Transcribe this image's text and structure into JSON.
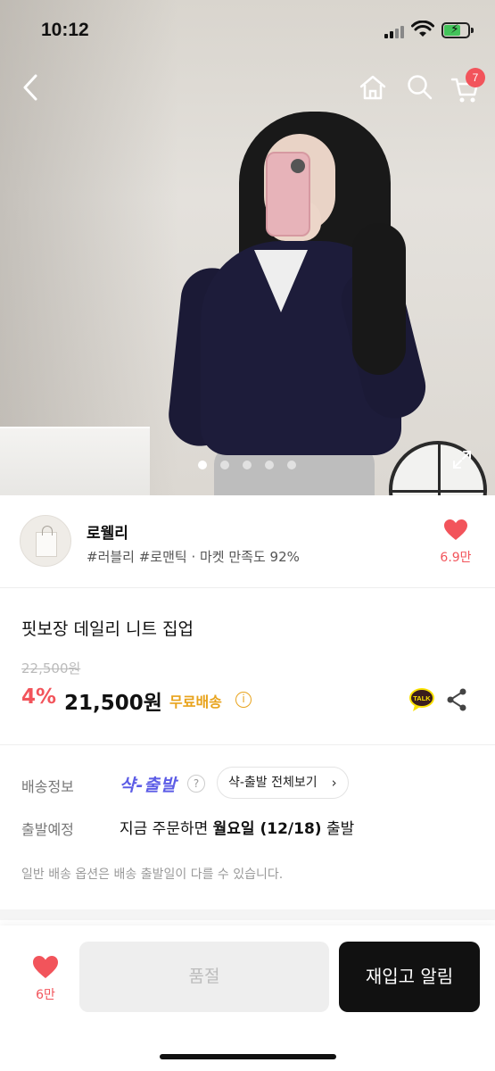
{
  "status_bar": {
    "time": "10:12"
  },
  "nav": {
    "cart_count": "7"
  },
  "carousel": {
    "dot_count": 5,
    "active_index": 0
  },
  "seller": {
    "name": "로웰리",
    "tags": "#러블리 #로맨틱 · 마켓 만족도 92%",
    "likes": "6.9만"
  },
  "product": {
    "title": "핏보장 데일리 니트 집업",
    "original_price": "22,500원",
    "discount": "4%",
    "price": "21,500원",
    "free_shipping": "무료배송",
    "info_glyph": "i",
    "kakao_label": "TALK"
  },
  "shipping": {
    "label": "배송정보",
    "brand": "샥-출발",
    "help_glyph": "?",
    "view_all": "샥-출발 전체보기",
    "departure_label": "출발예정",
    "departure_prefix": "지금 주문하면 ",
    "departure_day": "월요일 (12/18)",
    "departure_suffix": " 출발",
    "notice": "일반 배송 옵션은 배송 출발일이 다를 수 있습니다."
  },
  "bottom_bar": {
    "likes": "6만",
    "soldout_label": "품절",
    "restock_label": "재입고 알림"
  },
  "colors": {
    "accent": "#f2545b",
    "free_shipping": "#e8a31c",
    "shak_brand": "#5c5ce6",
    "primary_button": "#111111"
  },
  "icons": [
    "back-arrow-icon",
    "home-icon",
    "search-icon",
    "cart-icon",
    "expand-icon",
    "heart-icon",
    "kakao-talk-icon",
    "share-icon",
    "info-icon",
    "help-icon",
    "chevron-right-icon"
  ]
}
